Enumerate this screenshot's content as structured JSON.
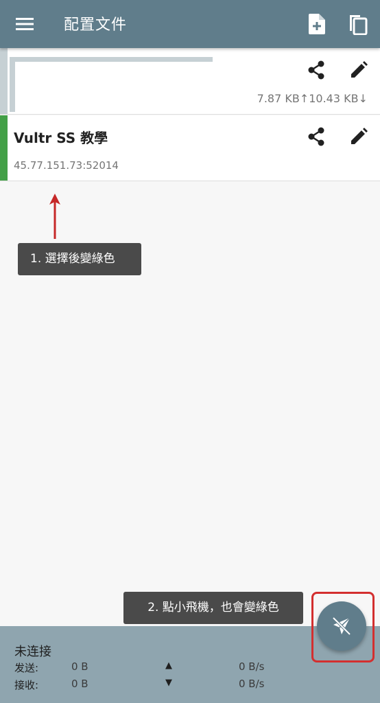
{
  "app_bar": {
    "title": "配置文件",
    "icons": [
      "menu-icon",
      "add-file-icon",
      "copy-icon"
    ]
  },
  "profiles": [
    {
      "name": "",
      "address": "",
      "traffic": "7.87 KB↑10.43 KB↓",
      "selected": false
    },
    {
      "name": "Vultr SS 教學",
      "address": "45.77.151.73:52014",
      "selected": true,
      "indicator_color": "#43a047"
    }
  ],
  "annotations": {
    "step1": "1. 選擇後變綠色",
    "step2": "2. 點小飛機，也會變綠色",
    "arrow_color": "#c62828",
    "highlight_color": "#d32f2f"
  },
  "status": {
    "state": "未连接",
    "send_label": "发送:",
    "send_bytes": "0 B",
    "send_arrow": "▲",
    "send_speed": "0 B/s",
    "recv_label": "接收:",
    "recv_bytes": "0 B",
    "recv_arrow": "▼",
    "recv_speed": "0 B/s"
  },
  "colors": {
    "primary": "#607d8b",
    "status_bg": "#8fa5af",
    "selected": "#43a047"
  }
}
